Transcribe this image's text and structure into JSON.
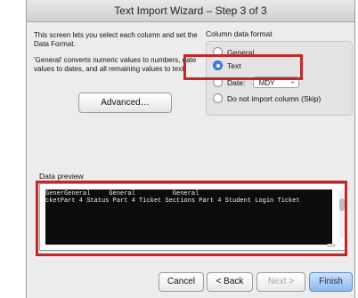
{
  "window": {
    "title": "Text Import Wizard – Step 3 of 3"
  },
  "intro": {
    "line1": "This screen lets you select each column and set the Data Format.",
    "line2": "'General' converts numeric values to numbers, date values to dates, and all remaining values to text."
  },
  "advanced_button": "Advanced…",
  "column_format": {
    "label": "Column data format",
    "options": [
      "General",
      "Text",
      "Date:",
      "Do not import column (Skip)"
    ],
    "selected": "Text",
    "date_format": "MDY"
  },
  "data_preview": {
    "label": "Data preview",
    "header_row": "GenerGeneral     General          General",
    "data_row": "cketPart 4 Status Part 4 Ticket Sections Part 4 Student Login Ticket"
  },
  "buttons": {
    "cancel": "Cancel",
    "back": "< Back",
    "next": "Next >",
    "finish": "Finish"
  },
  "colors": {
    "highlight": "#c3262b",
    "accent": "#3b82f6"
  }
}
